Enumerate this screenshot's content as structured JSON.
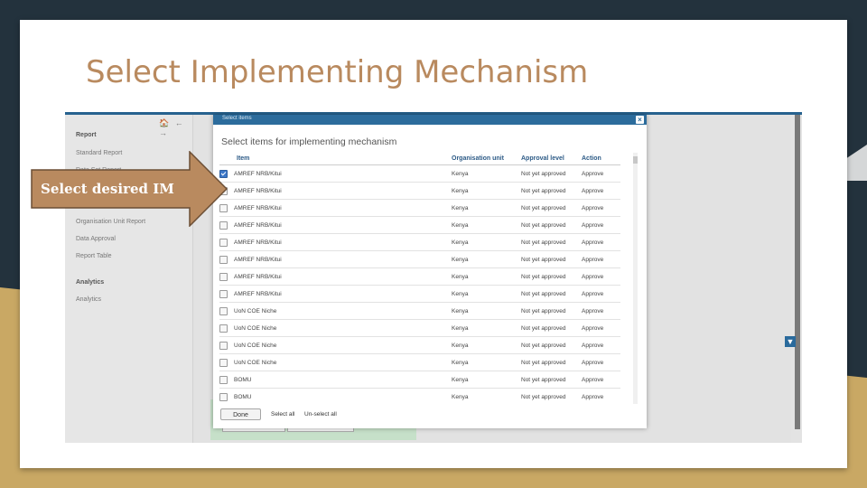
{
  "slide": {
    "title": "Select Implementing Mechanism",
    "callout_text": "Select desired IM",
    "colors": {
      "background": "#23323d",
      "accent_tan": "#c9a864",
      "callout_fill": "#b98a5f",
      "title": "#b98a5f"
    }
  },
  "app": {
    "nav_icons": "🏠 ← →",
    "sidebar": {
      "section_report": "Report",
      "report_items": [
        "Standard Report",
        "Data Set Report",
        "",
        "Organisation Unit Report",
        "Data Approval",
        "Report Table"
      ],
      "section_analytics": "Analytics",
      "analytics_items": [
        "Analytics"
      ]
    }
  },
  "dialog": {
    "title": "Select items",
    "close_icon": "×",
    "heading": "Select items for implementing mechanism",
    "columns": [
      "Item",
      "Organisation unit",
      "Approval level",
      "Action"
    ],
    "rows": [
      {
        "checked": true,
        "item": "AMREF NRB/Kitui",
        "org_unit": "Kenya",
        "approval_level": "Not yet approved",
        "action": "Approve"
      },
      {
        "checked": false,
        "item": "AMREF NRB/Kitui",
        "org_unit": "Kenya",
        "approval_level": "Not yet approved",
        "action": "Approve"
      },
      {
        "checked": false,
        "item": "AMREF NRB/Kitui",
        "org_unit": "Kenya",
        "approval_level": "Not yet approved",
        "action": "Approve"
      },
      {
        "checked": false,
        "item": "AMREF NRB/Kitui",
        "org_unit": "Kenya",
        "approval_level": "Not yet approved",
        "action": "Approve"
      },
      {
        "checked": false,
        "item": "AMREF NRB/Kitui",
        "org_unit": "Kenya",
        "approval_level": "Not yet approved",
        "action": "Approve"
      },
      {
        "checked": false,
        "item": "AMREF NRB/Kitui",
        "org_unit": "Kenya",
        "approval_level": "Not yet approved",
        "action": "Approve"
      },
      {
        "checked": false,
        "item": "AMREF NRB/Kitui",
        "org_unit": "Kenya",
        "approval_level": "Not yet approved",
        "action": "Approve"
      },
      {
        "checked": false,
        "item": "AMREF NRB/Kitui",
        "org_unit": "Kenya",
        "approval_level": "Not yet approved",
        "action": "Approve"
      },
      {
        "checked": false,
        "item": "UoN COE Niche",
        "org_unit": "Kenya",
        "approval_level": "Not yet approved",
        "action": "Approve"
      },
      {
        "checked": false,
        "item": "UoN COE Niche",
        "org_unit": "Kenya",
        "approval_level": "Not yet approved",
        "action": "Approve"
      },
      {
        "checked": false,
        "item": "UoN COE Niche",
        "org_unit": "Kenya",
        "approval_level": "Not yet approved",
        "action": "Approve"
      },
      {
        "checked": false,
        "item": "UoN COE Niche",
        "org_unit": "Kenya",
        "approval_level": "Not yet approved",
        "action": "Approve"
      },
      {
        "checked": false,
        "item": "BOMU",
        "org_unit": "Kenya",
        "approval_level": "Not yet approved",
        "action": "Approve"
      },
      {
        "checked": false,
        "item": "BOMU",
        "org_unit": "Kenya",
        "approval_level": "Not yet approved",
        "action": "Approve"
      }
    ],
    "footer": {
      "done_label": "Done",
      "select_all_label": "Select all",
      "unselect_all_label": "Un-select all"
    }
  }
}
